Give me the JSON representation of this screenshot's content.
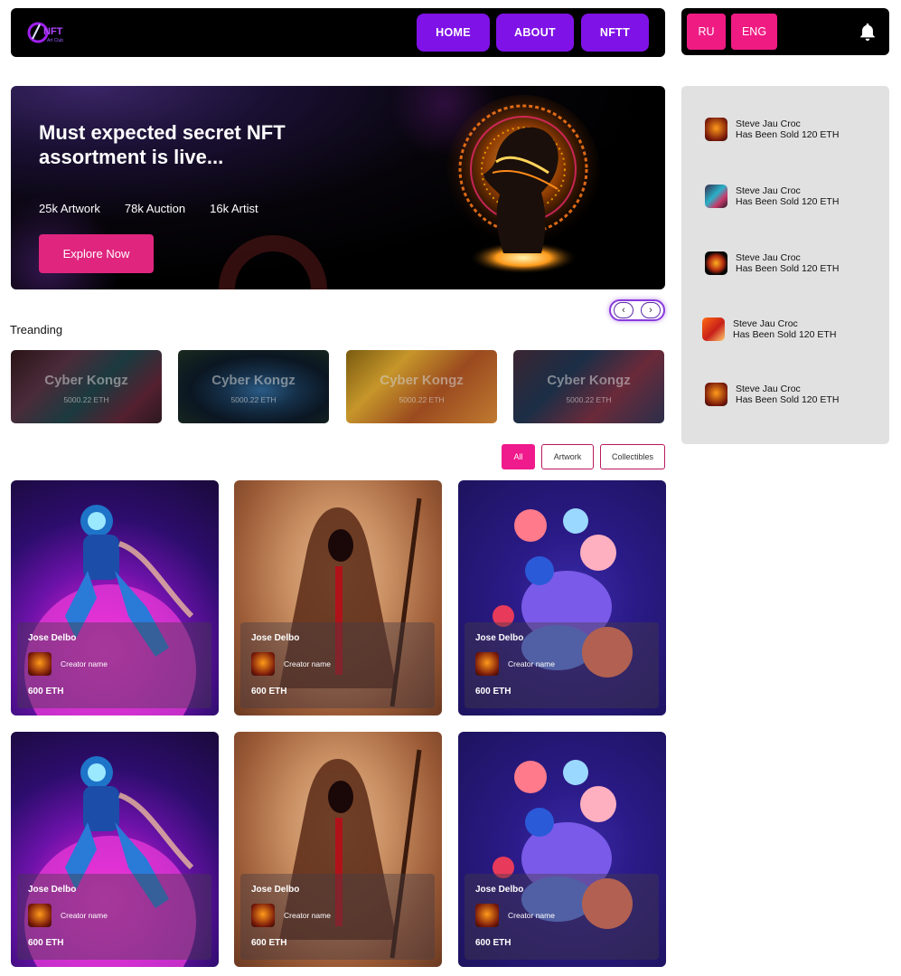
{
  "nav": {
    "logo_text": "NFT",
    "logo_sub": "Art Club",
    "home": "HOME",
    "about": "ABOUT",
    "nftt": "NFTT"
  },
  "lang": {
    "ru": "RU",
    "eng": "ENG",
    "bell_icon": "bell-icon"
  },
  "hero": {
    "title_line1": "Must expected secret NFT",
    "title_line2": "assortment is live...",
    "stats": [
      "25k Artwork",
      "78k Auction",
      "16k Artist"
    ],
    "cta": "Explore Now"
  },
  "slider": {
    "prev": "‹",
    "next": "›"
  },
  "trending": {
    "title": "Treanding",
    "items": [
      {
        "name": "Cyber Kongz",
        "price": "5000.22 ETH"
      },
      {
        "name": "Cyber Kongz",
        "price": "5000.22 ETH"
      },
      {
        "name": "Cyber Kongz",
        "price": "5000.22 ETH"
      },
      {
        "name": "Cyber Kongz",
        "price": "5000.22 ETH"
      }
    ]
  },
  "filters": {
    "all": "All",
    "artwork": "Artwork",
    "collectibles": "Collectibles",
    "active": "All"
  },
  "cards": [
    {
      "owner": "Jose Delbo",
      "creator": "Creator name",
      "price": "600 ETH",
      "art": "astronaut"
    },
    {
      "owner": "Jose Delbo",
      "creator": "Creator name",
      "price": "600 ETH",
      "art": "hooded-figure"
    },
    {
      "owner": "Jose Delbo",
      "creator": "Creator name",
      "price": "600 ETH",
      "art": "flower-sculpture"
    },
    {
      "owner": "Jose Delbo",
      "creator": "Creator name",
      "price": "600 ETH",
      "art": "astronaut"
    },
    {
      "owner": "Jose Delbo",
      "creator": "Creator name",
      "price": "600 ETH",
      "art": "hooded-figure"
    },
    {
      "owner": "Jose Delbo",
      "creator": "Creator name",
      "price": "600 ETH",
      "art": "flower-sculpture"
    }
  ],
  "sales": [
    {
      "name": "Steve Jau Croc",
      "text": "Has Been Sold 120 ETH"
    },
    {
      "name": "Steve Jau Croc",
      "text": "Has Been Sold 120 ETH"
    },
    {
      "name": "Steve Jau Croc",
      "text": "Has Been Sold 120 ETH"
    },
    {
      "name": "Steve Jau Croc",
      "text": "Has Been Sold 120 ETH"
    },
    {
      "name": "Steve Jau Croc",
      "text": "Has Been Sold 120 ETH"
    }
  ],
  "colors": {
    "nav_button": "#7f12e6",
    "pink": "#ef1b83",
    "cta": "#e0257f",
    "sidebar_bg": "#e1e1e1"
  }
}
